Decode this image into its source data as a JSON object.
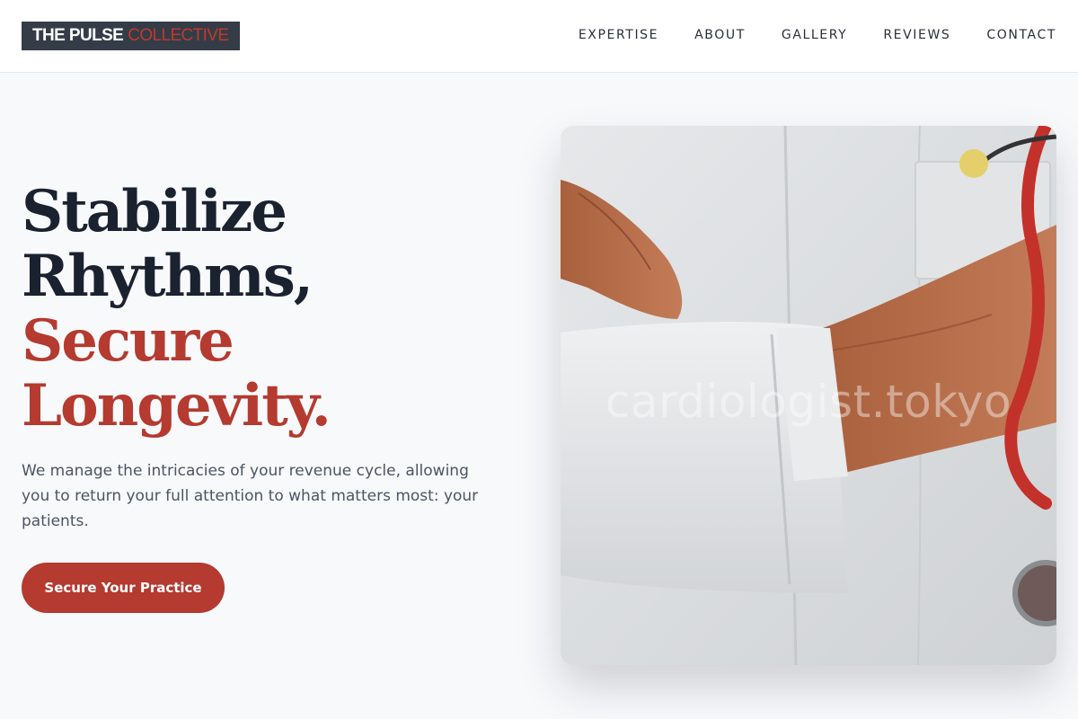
{
  "header": {
    "logo": {
      "part1": "THE PULSE",
      "part2": "COLLECTIVE"
    },
    "nav": [
      "EXPERTISE",
      "ABOUT",
      "GALLERY",
      "REVIEWS",
      "CONTACT"
    ]
  },
  "hero": {
    "title_line1": "Stabilize",
    "title_line2": "Rhythms,",
    "title_line3": "Secure",
    "title_line4": "Longevity.",
    "subtitle": "We manage the intricacies of your revenue cycle, allowing you to return your full attention to what matters most: your patients.",
    "cta": "Secure Your Practice"
  },
  "image": {
    "watermark": "cardiologist.tokyo",
    "subject": "doctor-in-white-coat-with-stethoscope"
  },
  "colors": {
    "brand_dark": "#343c48",
    "accent_red": "#b53a2f",
    "heading": "#1a2230",
    "body_text": "#4b5563",
    "background": "#f8f9fb"
  }
}
